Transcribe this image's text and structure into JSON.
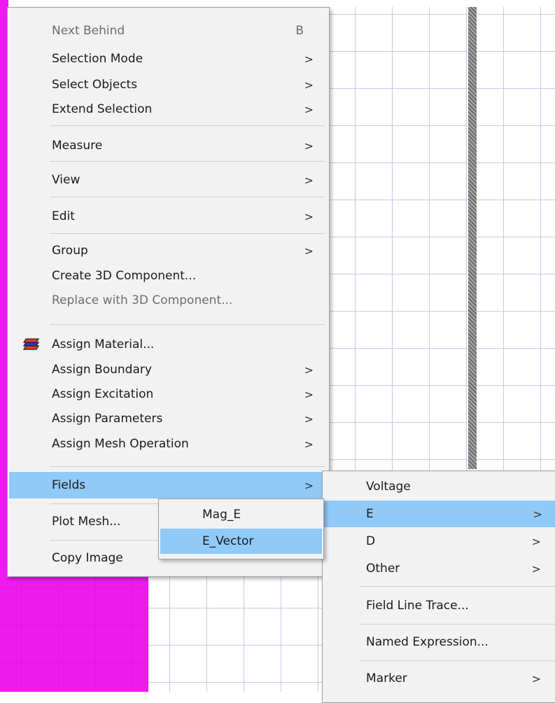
{
  "main_menu": {
    "items": [
      {
        "label": "Next Behind",
        "accel": "B",
        "disabled": true
      },
      {
        "label": "Selection Mode",
        "has_submenu": true
      },
      {
        "label": "Select Objects",
        "has_submenu": true
      },
      {
        "label": "Extend Selection",
        "has_submenu": true
      },
      {
        "label": "Measure",
        "has_submenu": true
      },
      {
        "label": "View",
        "has_submenu": true
      },
      {
        "label": "Edit",
        "has_submenu": true
      },
      {
        "label": "Group",
        "has_submenu": true
      },
      {
        "label": "Create 3D Component..."
      },
      {
        "label": "Replace with 3D Component...",
        "disabled": true
      },
      {
        "label": "Assign Material...",
        "icon": "material-stack-icon"
      },
      {
        "label": "Assign Boundary",
        "has_submenu": true
      },
      {
        "label": "Assign Excitation",
        "has_submenu": true
      },
      {
        "label": "Assign Parameters",
        "has_submenu": true
      },
      {
        "label": "Assign Mesh Operation",
        "has_submenu": true
      },
      {
        "label": "Fields",
        "has_submenu": true,
        "highlighted": true
      },
      {
        "label": "Plot Mesh..."
      },
      {
        "label": "Copy Image"
      }
    ],
    "submenu_arrow": ">"
  },
  "fields_submenu": {
    "items": [
      {
        "label": "Voltage"
      },
      {
        "label": "E",
        "has_submenu": true,
        "highlighted": true
      },
      {
        "label": "D",
        "has_submenu": true
      },
      {
        "label": "Other",
        "has_submenu": true
      },
      {
        "label": "Field Line Trace..."
      },
      {
        "label": "Named Expression..."
      },
      {
        "label": "Marker",
        "has_submenu": true
      }
    ]
  },
  "e_submenu": {
    "items": [
      {
        "label": "Mag_E"
      },
      {
        "label": "E_Vector",
        "highlighted": true
      }
    ]
  },
  "colors": {
    "menu_bg": "#f2f2f2",
    "highlight": "#91c9f7",
    "object_magenta": "#ee1aee",
    "grid_line": "#c9c8e6"
  }
}
